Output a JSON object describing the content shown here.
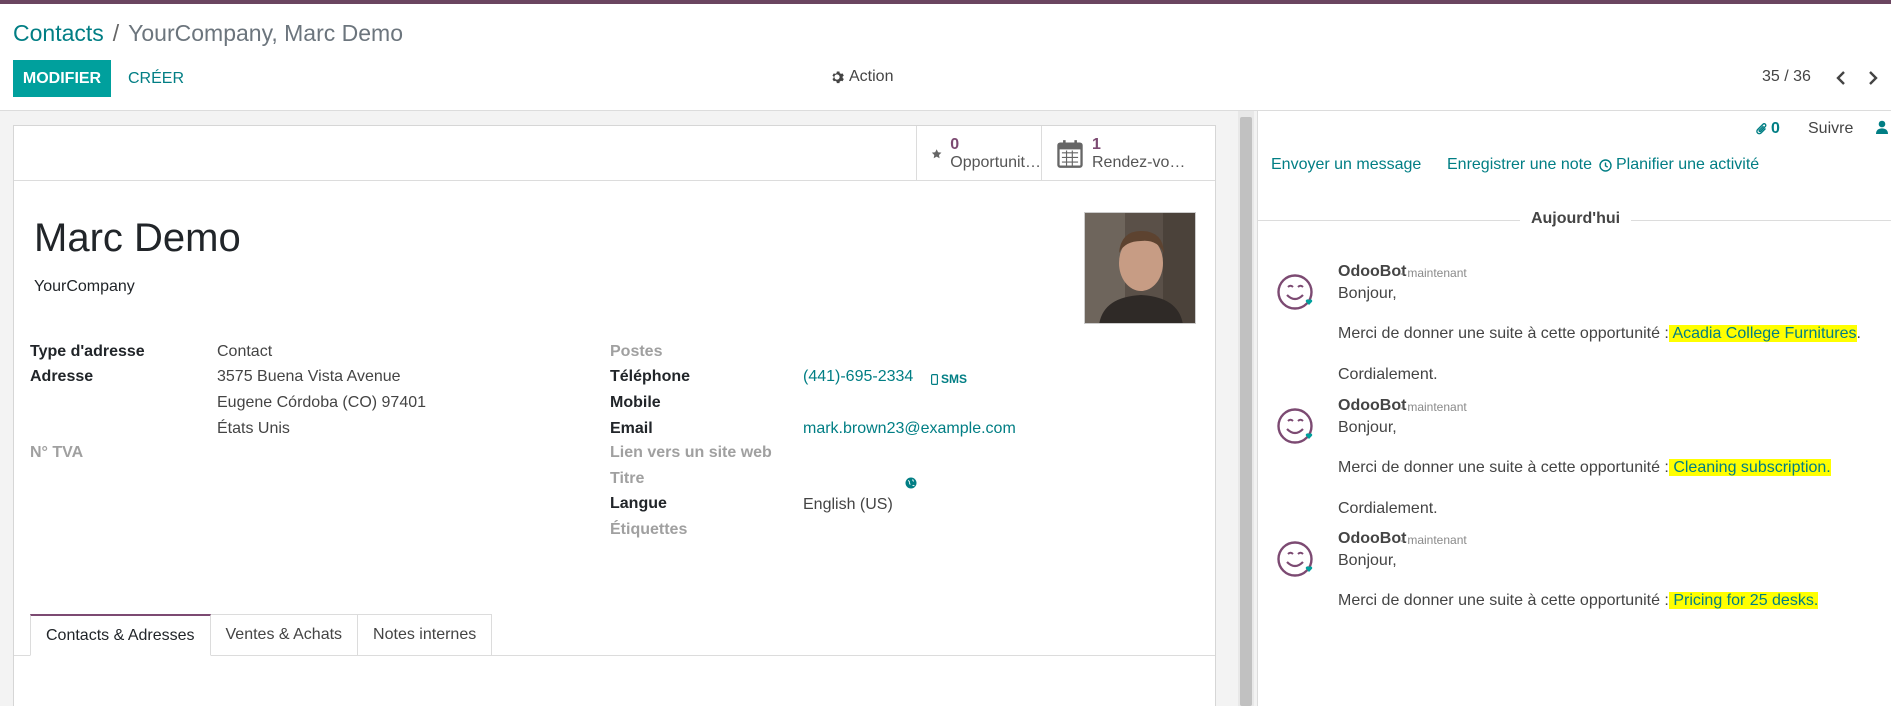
{
  "breadcrumb": {
    "parent": "Contacts",
    "separator": "/",
    "current": "YourCompany, Marc Demo"
  },
  "toolbar": {
    "edit_label": "MODIFIER",
    "create_label": "CRÉER",
    "action_label": "Action",
    "action_icon": "gear-icon"
  },
  "pager": {
    "value": "35 / 36"
  },
  "stat_buttons": [
    {
      "value": "0",
      "label": "Opportunit…",
      "icon": "star-icon"
    },
    {
      "value": "1",
      "label": "Rendez-vo…",
      "icon": "calendar-icon"
    }
  ],
  "partner": {
    "name": "Marc Demo",
    "company": "YourCompany"
  },
  "left_fields": {
    "address_type_label": "Type d'adresse",
    "address_type_value": "Contact",
    "address_label": "Adresse",
    "street": "3575 Buena Vista Avenue",
    "city_line": "Eugene  Córdoba (CO)  97401",
    "country": "États Unis",
    "vat_label": "N° TVA"
  },
  "right_fields": {
    "function_label": "Postes",
    "phone_label": "Téléphone",
    "phone_value": "(441)-695-2334",
    "sms_label": "SMS",
    "mobile_label": "Mobile",
    "email_label": "Email",
    "email_value": "mark.brown23@example.com",
    "website_label": "Lien vers un site web",
    "title_label": "Titre",
    "lang_label": "Langue",
    "lang_value": "English (US)",
    "tags_label": "Étiquettes"
  },
  "tabs": [
    {
      "label": "Contacts & Adresses",
      "active": true
    },
    {
      "label": "Ventes & Achats",
      "active": false
    },
    {
      "label": "Notes internes",
      "active": false
    }
  ],
  "chatter": {
    "attachments_count": "0",
    "follow_label": "Suivre",
    "send_message_label": "Envoyer un message",
    "log_note_label": "Enregistrer une note",
    "schedule_activity_label": "Planifier une activité",
    "date_separator": "Aujourd'hui",
    "messages": [
      {
        "author": "OdooBot",
        "date": "- maintenant",
        "greeting": "Bonjour,",
        "body_prefix": "Merci de donner une suite à cette opportunité :",
        "link": " Acadia College Furnitures",
        "suffix": ".",
        "closing": "Cordialement."
      },
      {
        "author": "OdooBot",
        "date": "- maintenant",
        "greeting": "Bonjour,",
        "body_prefix": "Merci de donner une suite à cette opportunité :",
        "link": " Cleaning subscription.",
        "suffix": "",
        "closing": "Cordialement."
      },
      {
        "author": "OdooBot",
        "date": "- maintenant",
        "greeting": "Bonjour,",
        "body_prefix": "Merci de donner une suite à cette opportunité :",
        "link": " Pricing for 25 desks.",
        "suffix": "",
        "closing": ""
      }
    ]
  },
  "colors": {
    "brand": "#6b4560",
    "primary": "#00a09d",
    "link": "#017e84",
    "highlight": "#ffff00"
  }
}
